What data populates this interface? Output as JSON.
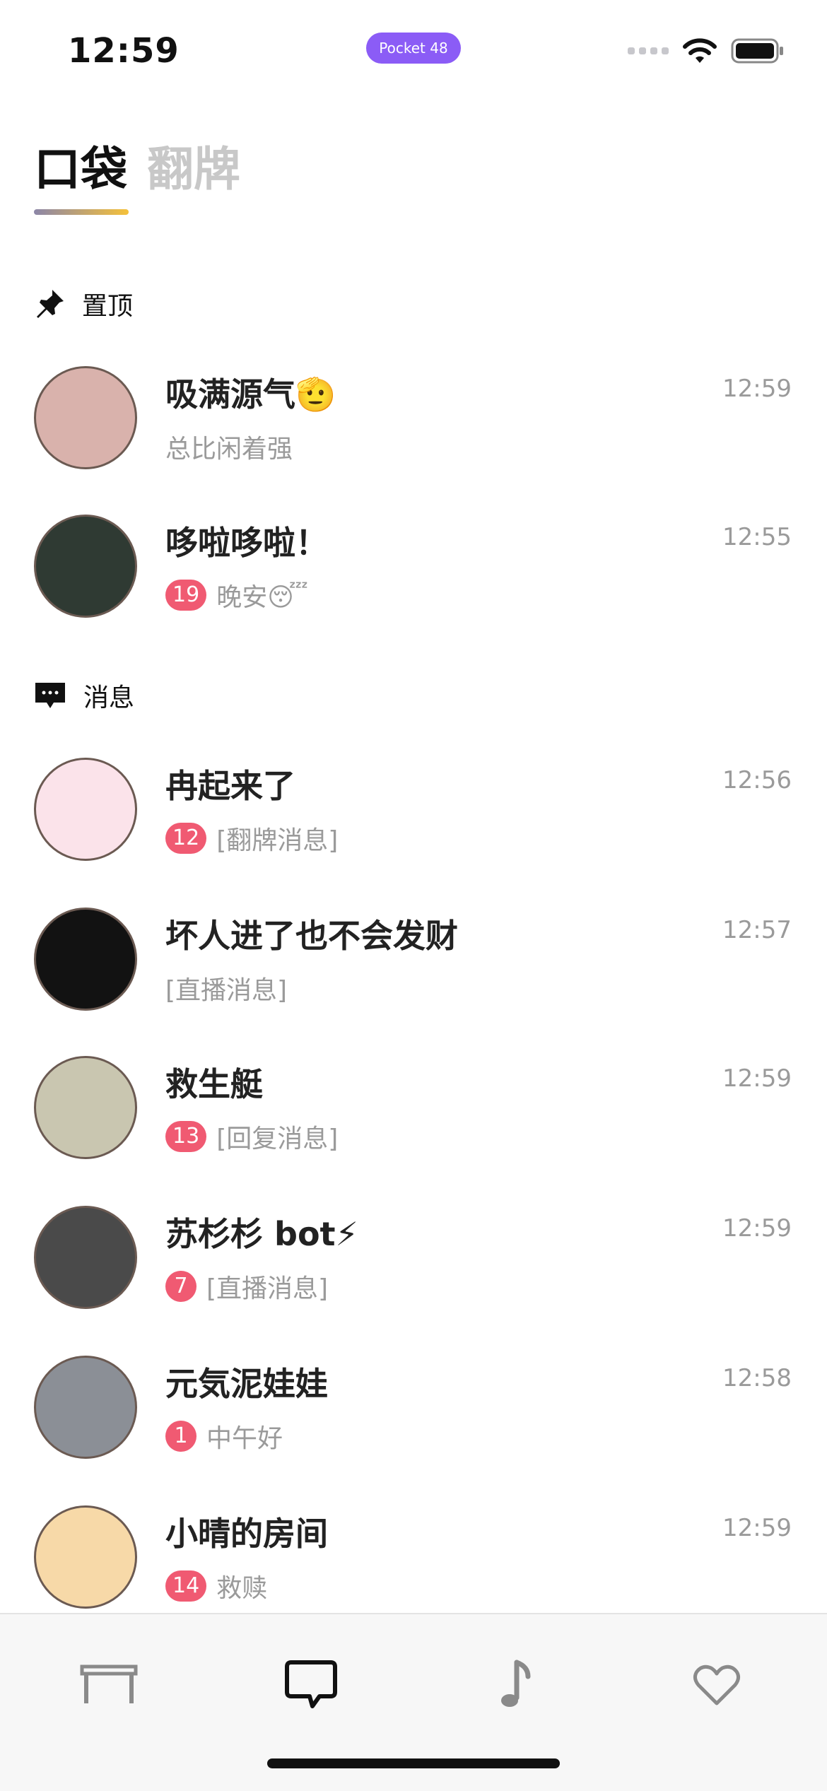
{
  "status_bar": {
    "time": "12:59",
    "app_pill": "Pocket 48",
    "icons": [
      "signal-icon",
      "wifi-icon",
      "battery-icon"
    ]
  },
  "top_tabs": {
    "active": "口袋",
    "inactive": "翻牌"
  },
  "sections": {
    "pinned": {
      "label": "置顶",
      "icon": "pin-icon"
    },
    "messages": {
      "label": "消息",
      "icon": "chat-bubble-icon"
    }
  },
  "conversations": [
    {
      "title": "吸满源气🫡",
      "time": "12:59",
      "badge": "",
      "preview": "总比闲着强",
      "avatar_color": "#d9b2ac"
    },
    {
      "title": "哆啦哆啦！",
      "time": "12:55",
      "badge": "19",
      "preview": "晚安😴",
      "avatar_color": "#2f3a33"
    },
    {
      "title": "冉起来了",
      "time": "12:56",
      "badge": "12",
      "preview": "[翻牌消息]",
      "avatar_color": "#fbe3ea"
    },
    {
      "title": "坏人进了也不会发财",
      "time": "12:57",
      "badge": "",
      "preview": "[直播消息]",
      "avatar_color": "#121212"
    },
    {
      "title": "救生艇",
      "time": "12:59",
      "badge": "13",
      "preview": "[回复消息]",
      "avatar_color": "#c9c6b0"
    },
    {
      "title": "苏杉杉 bot⚡",
      "time": "12:59",
      "badge": "7",
      "preview": "[直播消息]",
      "avatar_color": "#4a4a4a"
    },
    {
      "title": "元気泥娃娃",
      "time": "12:58",
      "badge": "1",
      "preview": "中午好",
      "avatar_color": "#8b8f96"
    },
    {
      "title": "小晴的房间",
      "time": "12:59",
      "badge": "14",
      "preview": "救赎",
      "avatar_color": "#f7d9a8"
    }
  ],
  "tab_bar": {
    "items": [
      "table-icon",
      "chat-icon",
      "music-note-icon",
      "heart-icon"
    ],
    "active_index": 1
  }
}
